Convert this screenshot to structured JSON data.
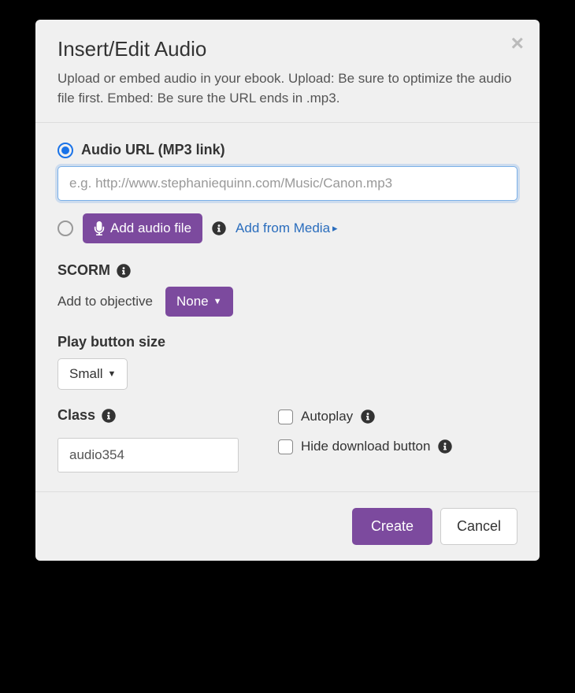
{
  "header": {
    "title": "Insert/Edit Audio",
    "description": "Upload or embed audio in your ebook. Upload: Be sure to optimize the audio file first. Embed: Be sure the URL ends in .mp3."
  },
  "url_option": {
    "label": "Audio URL (MP3 link)",
    "placeholder": "e.g. http://www.stephaniequinn.com/Music/Canon.mp3",
    "value": ""
  },
  "upload_option": {
    "button_label": "Add audio file",
    "media_link": "Add from Media"
  },
  "scorm": {
    "title": "SCORM",
    "objective_label": "Add to objective",
    "objective_value": "None"
  },
  "play_size": {
    "title": "Play button size",
    "value": "Small"
  },
  "class_field": {
    "title": "Class",
    "value": "audio354"
  },
  "checkboxes": {
    "autoplay_label": "Autoplay",
    "hide_download_label": "Hide download button"
  },
  "footer": {
    "create": "Create",
    "cancel": "Cancel"
  }
}
